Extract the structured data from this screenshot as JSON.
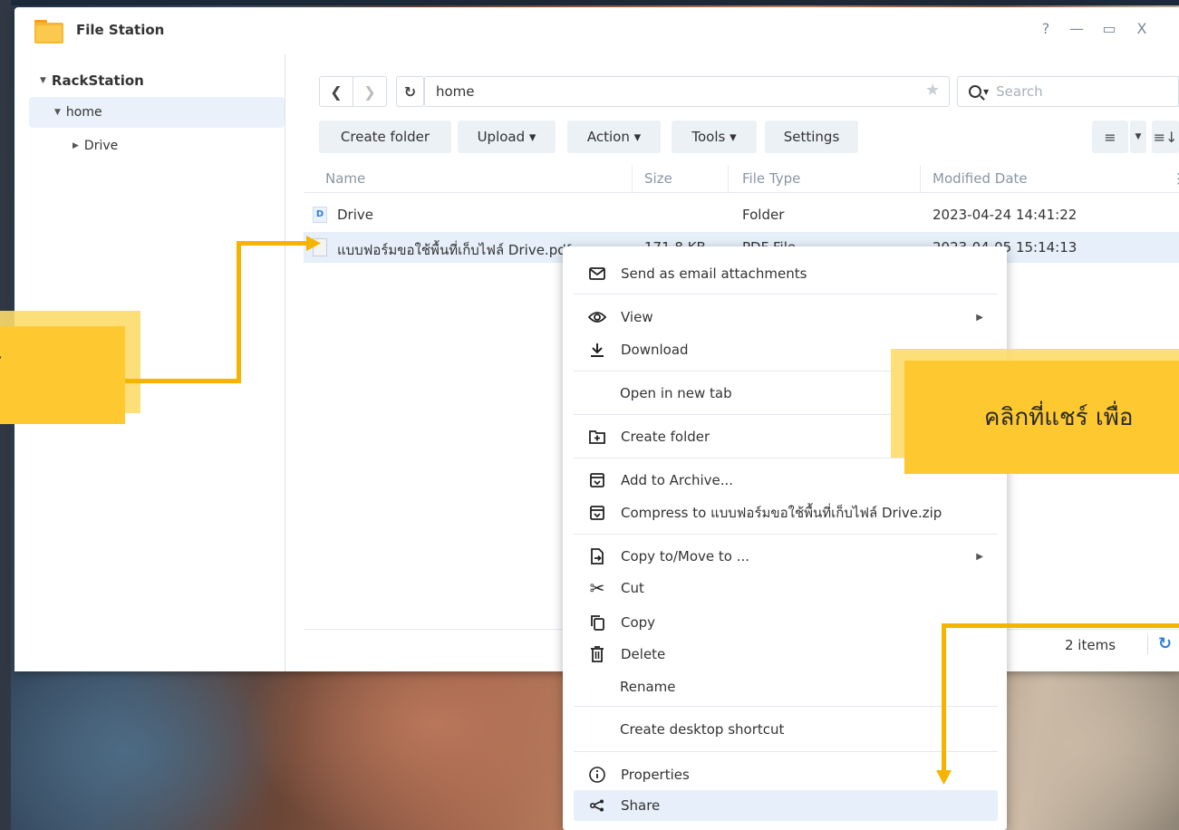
{
  "window": {
    "title": "File Station",
    "controls": {
      "help": "?",
      "minimize": "—",
      "maximize": "▭",
      "close": "X"
    }
  },
  "sidebar": {
    "root": "RackStation",
    "items": [
      {
        "label": "home",
        "expanded": true,
        "selected": true
      },
      {
        "label": "Drive",
        "expanded": false
      }
    ]
  },
  "toolbar": {
    "path": "home",
    "search_placeholder": "Search",
    "buttons": [
      "Create folder",
      "Upload ▾",
      "Action ▾",
      "Tools ▾",
      "Settings"
    ]
  },
  "table": {
    "columns": [
      "Name",
      "Size",
      "File Type",
      "Modified Date"
    ],
    "rows": [
      {
        "name": "Drive",
        "size": "",
        "type": "Folder",
        "modified": "2023-04-24 14:41:22",
        "icon": "folder-icon"
      },
      {
        "name": "แบบฟอร์มขอใช้พื้นที่เก็บไฟล์ Drive.pdf",
        "size": "171.8 KB",
        "type": "PDF File",
        "modified": "2023-04-05 15:14:13",
        "icon": "pdf-icon",
        "selected": true
      }
    ]
  },
  "status": {
    "items": "2 items"
  },
  "context_menu": {
    "items": [
      {
        "label": "Send as email attachments",
        "icon": "mail-icon"
      },
      {
        "label": "View",
        "icon": "eye-icon",
        "submenu": true
      },
      {
        "label": "Download",
        "icon": "download-icon"
      },
      {
        "label": "Open in new tab"
      },
      {
        "label": "Create folder",
        "icon": "new-folder-icon"
      },
      {
        "label": "Add to Archive...",
        "icon": "archive-icon"
      },
      {
        "label": "Compress to แบบฟอร์มขอใช้พื้นที่เก็บไฟล์ Drive.zip",
        "icon": "archive-icon"
      },
      {
        "label": "Copy to/Move to ...",
        "icon": "copy-move-icon",
        "submenu": true
      },
      {
        "label": "Cut",
        "icon": "scissors-icon"
      },
      {
        "label": "Copy",
        "icon": "copy-icon"
      },
      {
        "label": "Delete",
        "icon": "trash-icon"
      },
      {
        "label": "Rename"
      },
      {
        "label": "Create desktop shortcut"
      },
      {
        "label": "Properties",
        "icon": "info-icon"
      },
      {
        "label": "Share",
        "icon": "share-icon",
        "highlighted": true
      }
    ]
  },
  "annotations": {
    "left_text": "ร",
    "right_text": "คลิกที่แชร์ เพื่อ",
    "accent": "#fec831",
    "arrow_color": "#f5b400"
  }
}
